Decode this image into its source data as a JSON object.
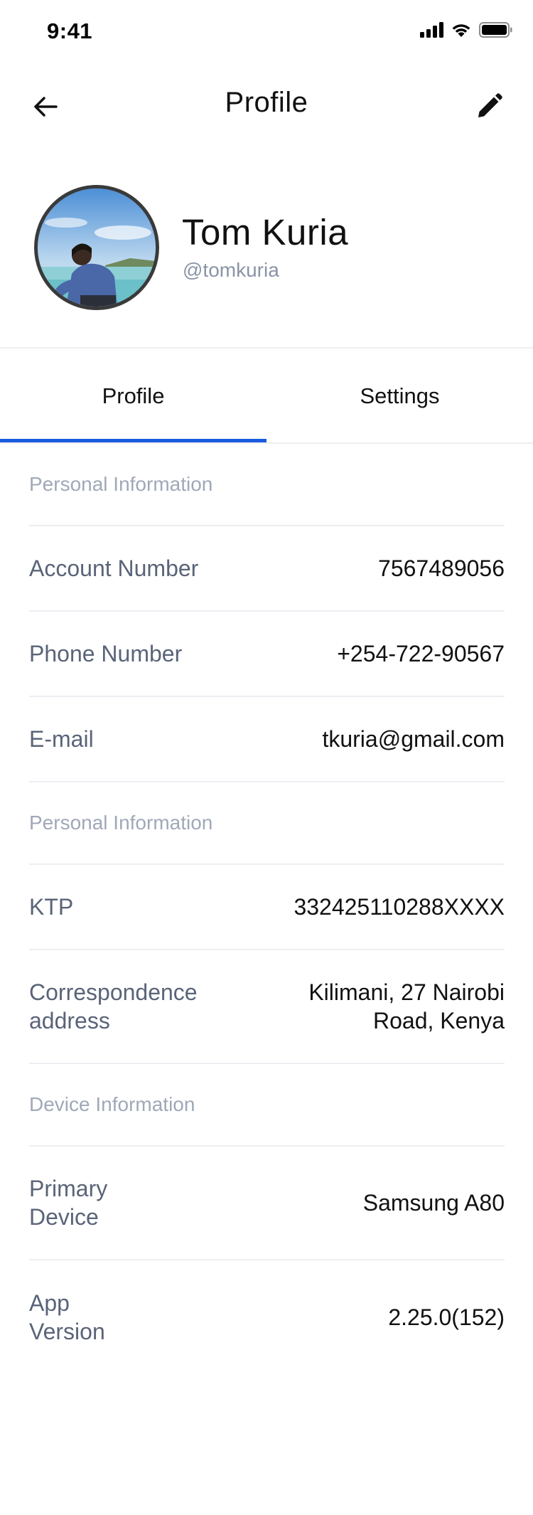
{
  "status_bar": {
    "time": "9:41"
  },
  "nav": {
    "title": "Profile",
    "back_icon": "arrow-left-icon",
    "edit_icon": "pencil-icon"
  },
  "user": {
    "name": "Tom Kuria",
    "handle": "@tomkuria"
  },
  "tabs": [
    {
      "label": "Profile",
      "active": true
    },
    {
      "label": "Settings",
      "active": false
    }
  ],
  "sections": {
    "personal_1": {
      "title": "Personal Information",
      "rows": [
        {
          "label": "Account Number",
          "value": "7567489056"
        },
        {
          "label": "Phone Number",
          "value": "+254-722-90567"
        },
        {
          "label": "E-mail",
          "value": "tkuria@gmail.com"
        }
      ]
    },
    "personal_2": {
      "title": "Personal Information",
      "rows": [
        {
          "label": "KTP",
          "value": "332425110288XXXX"
        },
        {
          "label": "Correspondence address",
          "value": "Kilimani, 27 Nairobi Road, Kenya"
        }
      ]
    },
    "device": {
      "title": "Device Information",
      "rows": [
        {
          "label": "Primary Device",
          "value": "Samsung A80"
        },
        {
          "label": "App Version",
          "value": "2.25.0(152)"
        }
      ]
    }
  },
  "colors": {
    "accent": "#1b5be0",
    "label": "#5a6478",
    "section_title": "#a0a8b8",
    "divider": "#eceef2"
  }
}
